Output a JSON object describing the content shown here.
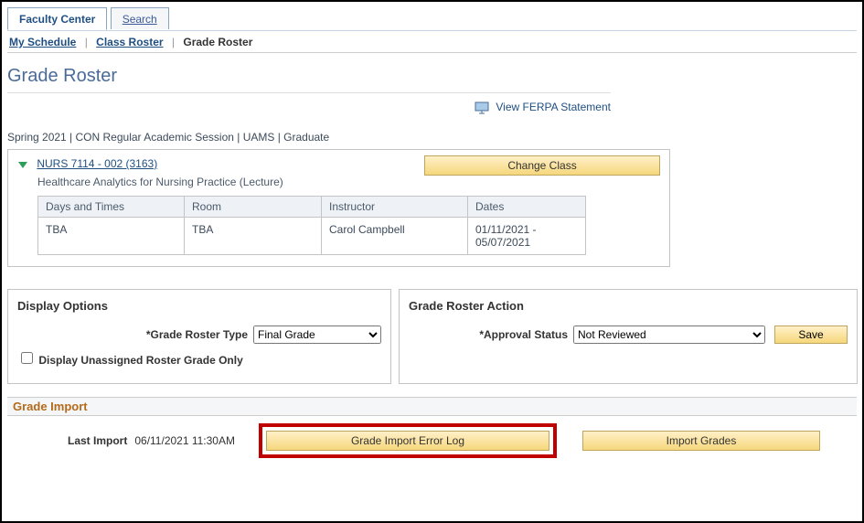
{
  "tabs": {
    "faculty_center": "Faculty Center",
    "search": "Search"
  },
  "subnav": {
    "my_schedule": "My Schedule",
    "class_roster": "Class Roster",
    "grade_roster": "Grade Roster"
  },
  "page_title": "Grade Roster",
  "ferpa_link": "View FERPA Statement",
  "term_line": "Spring 2021 | CON Regular Academic Session | UAMS | Graduate",
  "change_class_label": "Change Class",
  "class": {
    "link": "NURS 7114 - 002 (3163)",
    "desc": "Healthcare Analytics for Nursing Practice (Lecture)"
  },
  "schedule": {
    "headers": {
      "days_times": "Days and Times",
      "room": "Room",
      "instructor": "Instructor",
      "dates": "Dates"
    },
    "row": {
      "days_times": "TBA",
      "room": "TBA",
      "instructor": "Carol Campbell",
      "dates": "01/11/2021 - 05/07/2021"
    }
  },
  "display_options": {
    "title": "Display Options",
    "roster_type_label": "*Grade Roster Type",
    "roster_type_value": "Final Grade",
    "unassigned_label": "Display Unassigned Roster Grade Only"
  },
  "roster_action": {
    "title": "Grade Roster Action",
    "approval_label": "*Approval Status",
    "approval_value": "Not Reviewed",
    "save_label": "Save"
  },
  "import": {
    "title": "Grade Import",
    "last_import_label": "Last Import",
    "last_import_value": "06/11/2021 11:30AM",
    "error_log_label": "Grade Import Error Log",
    "import_grades_label": "Import Grades"
  }
}
